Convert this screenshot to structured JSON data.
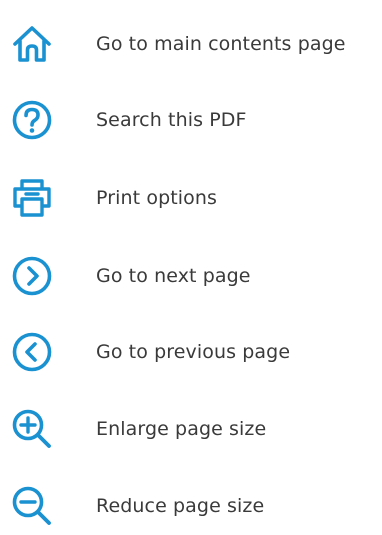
{
  "theme": {
    "icon_color": "#1a91d1",
    "text_color": "#3a3a3a"
  },
  "items": [
    {
      "icon": "home-icon",
      "label": "Go to main contents page"
    },
    {
      "icon": "help-icon",
      "label": "Search this PDF"
    },
    {
      "icon": "printer-icon",
      "label": "Print options"
    },
    {
      "icon": "chevron-right-circle-icon",
      "label": "Go to next page"
    },
    {
      "icon": "chevron-left-circle-icon",
      "label": "Go to previous page"
    },
    {
      "icon": "zoom-in-icon",
      "label": "Enlarge page size"
    },
    {
      "icon": "zoom-out-icon",
      "label": "Reduce page size"
    }
  ]
}
